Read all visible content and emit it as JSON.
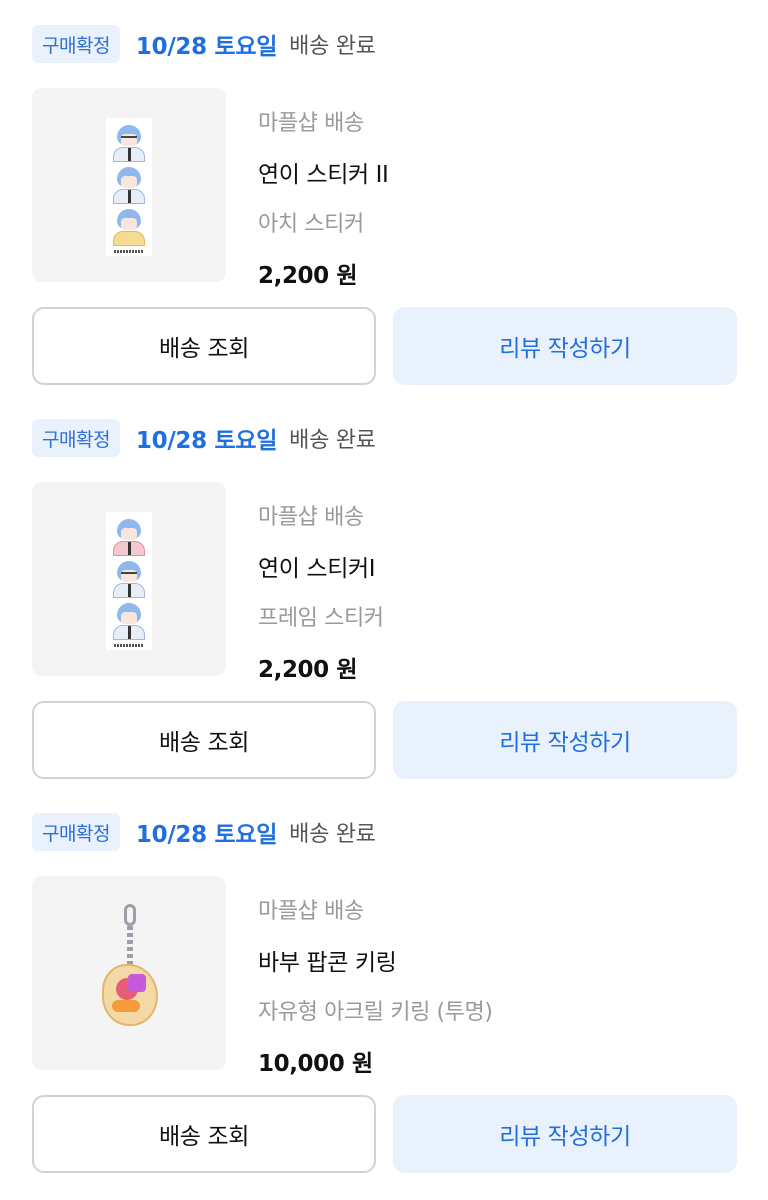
{
  "orders": [
    {
      "badge": "구매확정",
      "date": "10/28 토요일",
      "status": "배송 완료",
      "image_icon": "sticker-strip-thumbnail",
      "seller": "마플샵 배송",
      "product_name": "연이 스티커 II",
      "option": "아치 스티커",
      "price": "2,200 원",
      "track_label": "배송 조회",
      "review_label": "리뷰 작성하기"
    },
    {
      "badge": "구매확정",
      "date": "10/28 토요일",
      "status": "배송 완료",
      "image_icon": "sticker-strip-thumbnail",
      "seller": "마플샵 배송",
      "product_name": "연이 스티커I",
      "option": "프레임 스티커",
      "price": "2,200 원",
      "track_label": "배송 조회",
      "review_label": "리뷰 작성하기"
    },
    {
      "badge": "구매확정",
      "date": "10/28 토요일",
      "status": "배송 완료",
      "image_icon": "acrylic-keyring-thumbnail",
      "seller": "마플샵 배송",
      "product_name": "바부 팝콘 키링",
      "option": "자유형 아크릴 키링 (투명)",
      "price": "10,000 원",
      "track_label": "배송 조회",
      "review_label": "리뷰 작성하기"
    }
  ],
  "colors": {
    "accent": "#1f6fe0",
    "badge_bg": "#e9f1fd",
    "muted_text": "#9a9a9a",
    "button_border": "#d2d2d2"
  }
}
